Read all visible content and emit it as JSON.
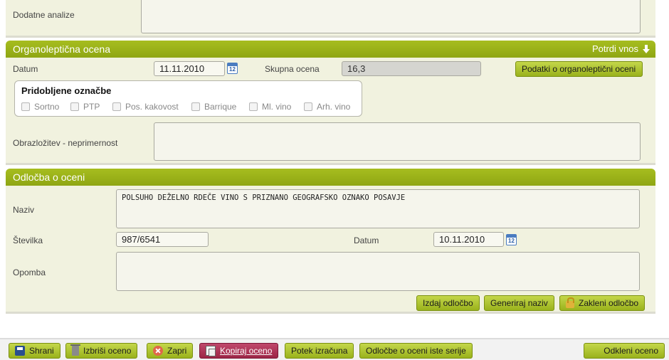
{
  "top": {
    "dodatne_label": "Dodatne analize"
  },
  "organo": {
    "title": "Organoleptična ocena",
    "confirm_label": "Potrdi vnos",
    "datum_label": "Datum",
    "datum_value": "11.11.2010",
    "calendar_day": "12",
    "skupna_label": "Skupna ocena",
    "skupna_value": "16,3",
    "podatki_button": "Podatki o organoleptični oceni",
    "oznacbe": {
      "title": "Pridobljene označbe",
      "items": [
        "Sortno",
        "PTP",
        "Pos. kakovost",
        "Barrique",
        "Ml. vino",
        "Arh. vino"
      ]
    },
    "obrazlozitev_label": "Obrazložitev - neprimernost"
  },
  "odlocba": {
    "title": "Odločba o oceni",
    "naziv_label": "Naziv",
    "naziv_value": "POLSUHO DEŽELNO RDEČE VINO S PRIZNANO GEOGRAFSKO OZNAKO POSAVJE",
    "stevilka_label": "Številka",
    "stevilka_value": "987/6541",
    "datum_label": "Datum",
    "datum_value": "10.11.2010",
    "opomba_label": "Opomba",
    "izdaj_button": "Izdaj odločbo",
    "generiraj_button": "Generiraj naziv",
    "zakleni_button": "Zakleni odločbo"
  },
  "bottom": {
    "shrani": "Shrani",
    "izbrisi": "Izbriši oceno",
    "zapri": "Zapri",
    "kopiraj": "Kopiraj oceno",
    "potek": "Potek izračuna",
    "odlocbe_serije": "Odločbe o oceni iste serije",
    "odkleni": "Odkleni oceno"
  },
  "colors": {
    "header_green": "#9ab21c",
    "panel_bg": "#f1f2df",
    "danger_button": "#9c2646"
  },
  "icons": {
    "calendar": "calendar-icon",
    "confirm": "arrow-down-icon",
    "save": "floppy-disk-icon",
    "delete": "trash-icon",
    "close": "close-circle-icon",
    "copy": "copy-icon",
    "lock": "lock-icon"
  }
}
